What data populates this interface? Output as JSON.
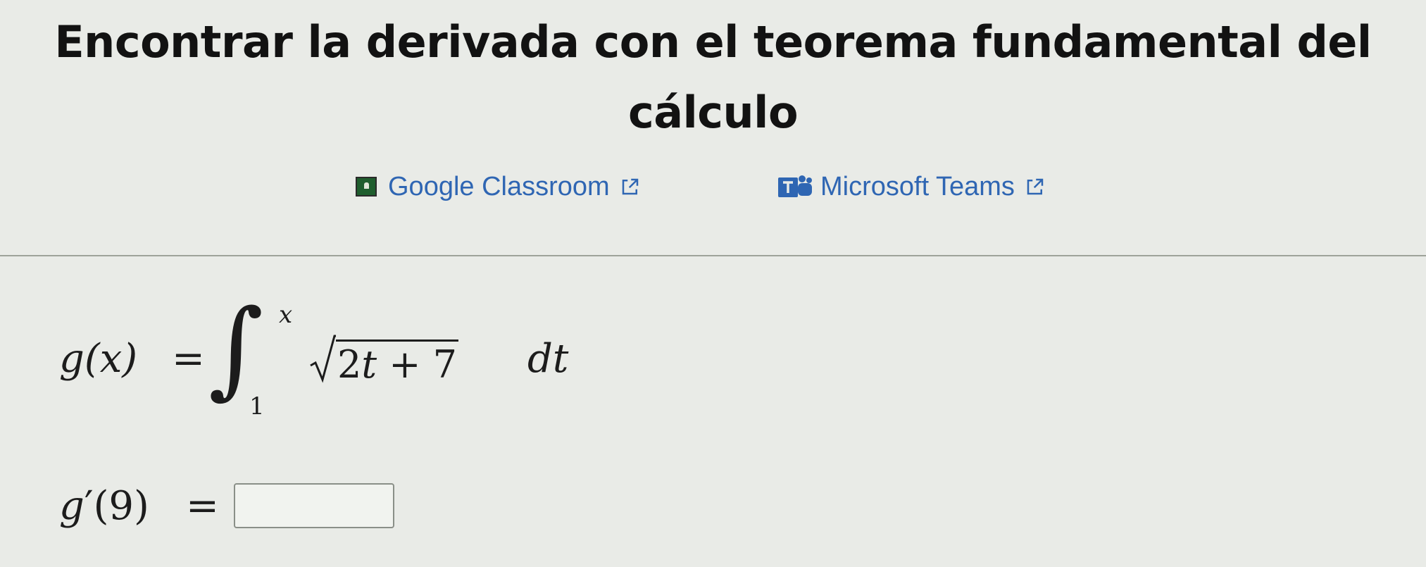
{
  "title": {
    "line1": "Encontrar la derivada con el teorema fundamental del",
    "line2": "cálculo"
  },
  "share": {
    "classroom": {
      "label": "Google Classroom",
      "icon": "google-classroom-icon"
    },
    "teams": {
      "label": "Microsoft Teams",
      "icon": "microsoft-teams-icon"
    },
    "external_icon": "external-link-icon",
    "link_color": "#2f66b3"
  },
  "problem": {
    "function_lhs": "g(x)",
    "equals": "=",
    "integral_symbol": "∫",
    "upper_limit": "x",
    "lower_limit": "1",
    "radicand_coef": "2",
    "radicand_var": "t",
    "radicand_op": " + ",
    "radicand_const": "7",
    "differential": "dt"
  },
  "answer": {
    "function": "g",
    "prime": "′",
    "argument": "(9)",
    "equals": "=",
    "value": "",
    "placeholder": ""
  }
}
